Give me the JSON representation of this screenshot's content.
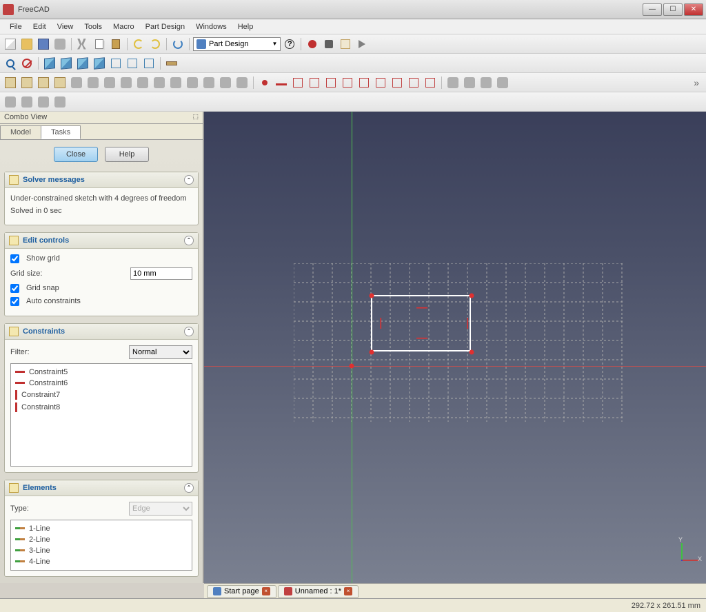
{
  "app": {
    "title": "FreeCAD"
  },
  "menu": [
    "File",
    "Edit",
    "View",
    "Tools",
    "Macro",
    "Part Design",
    "Windows",
    "Help"
  ],
  "workbench": "Part Design",
  "combo": {
    "title": "Combo View",
    "tabs": [
      "Model",
      "Tasks"
    ],
    "active_tab": "Tasks"
  },
  "task_buttons": {
    "close": "Close",
    "help": "Help"
  },
  "solver": {
    "title": "Solver messages",
    "msg1": "Under-constrained sketch with 4 degrees of freedom",
    "msg2": "Solved in 0 sec"
  },
  "edit_controls": {
    "title": "Edit controls",
    "show_grid_label": "Show grid",
    "show_grid": true,
    "grid_size_label": "Grid size:",
    "grid_size_value": "10 mm",
    "grid_snap_label": "Grid snap",
    "grid_snap": true,
    "auto_label": "Auto constraints",
    "auto": true
  },
  "constraints": {
    "title": "Constraints",
    "filter_label": "Filter:",
    "filter_value": "Normal",
    "items": [
      "Constraint5",
      "Constraint6",
      "Constraint7",
      "Constraint8"
    ]
  },
  "elements": {
    "title": "Elements",
    "type_label": "Type:",
    "type_value": "Edge",
    "items": [
      "1-Line",
      "2-Line",
      "3-Line",
      "4-Line"
    ]
  },
  "doc_tabs": {
    "start": "Start page",
    "unnamed": "Unnamed : 1*"
  },
  "status": {
    "coords": "292.72 x 261.51 mm"
  },
  "gizmo": {
    "x": "X",
    "y": "Y"
  }
}
